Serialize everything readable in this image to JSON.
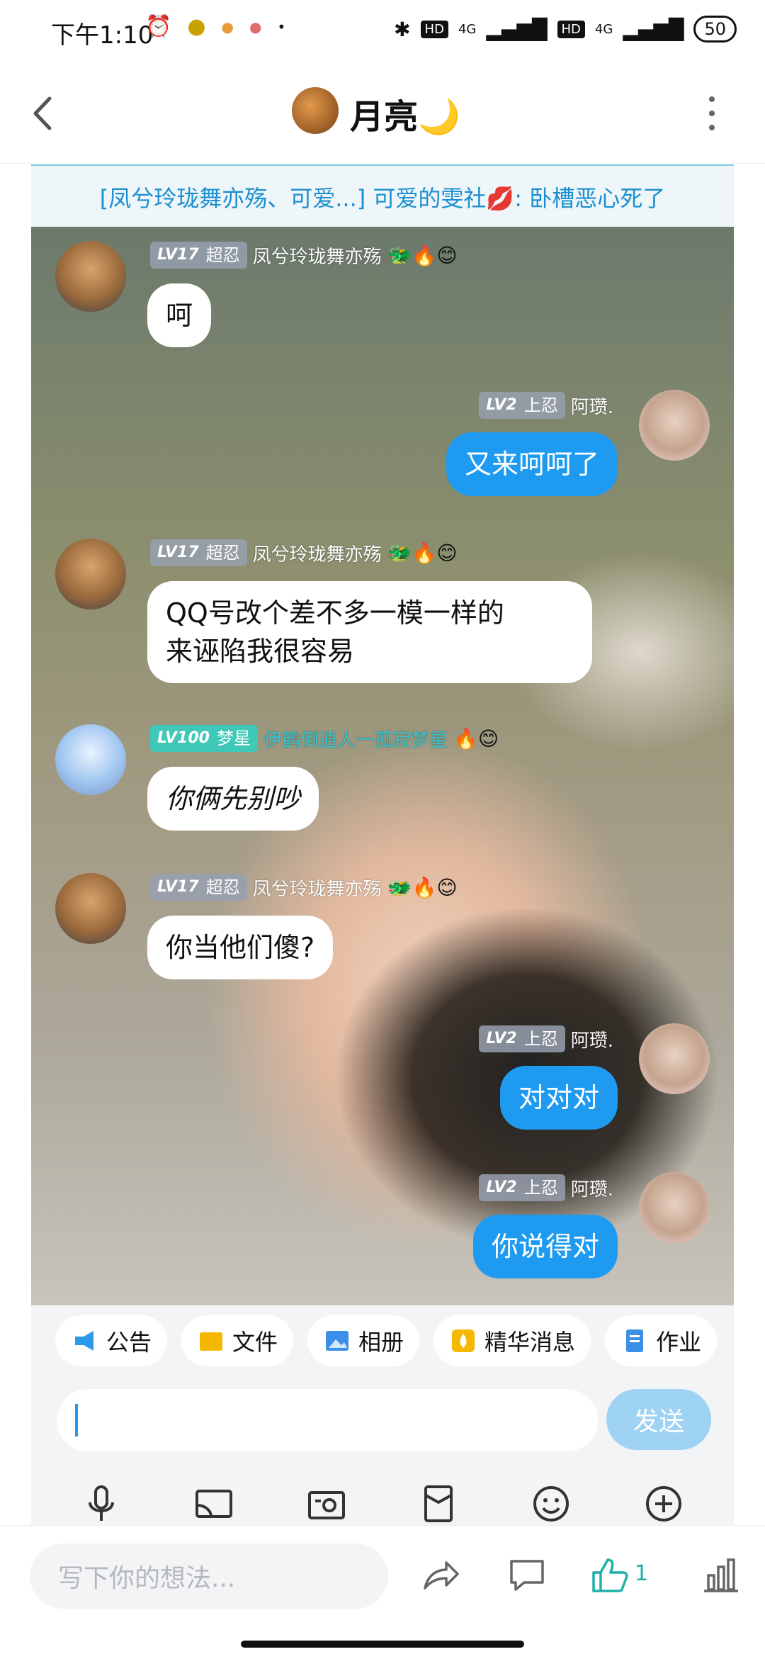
{
  "status_bar": {
    "time": "下午1:10",
    "battery": "50",
    "network_1": "4G",
    "network_2": "4G",
    "hd_1": "HD",
    "hd_2": "HD"
  },
  "header": {
    "title": "月亮🌙"
  },
  "marquee": {
    "text": "[凤兮玲珑舞亦殇、可爱...] 可爱的雯社💋: 卧槽恶心死了"
  },
  "messages": [
    {
      "side": "left",
      "avatar": "dog-avatar",
      "level": "LV17",
      "rank": "超忍",
      "sender": "凤兮玲珑舞亦殇",
      "emojis": "🐲🔥😊",
      "text": "呵"
    },
    {
      "side": "right",
      "avatar": "cat-avatar",
      "level": "LV2",
      "rank": "上忍",
      "sender": "阿瓒.",
      "text": "又来呵呵了"
    },
    {
      "side": "left",
      "avatar": "dog-avatar",
      "level": "LV17",
      "rank": "超忍",
      "sender": "凤兮玲珑舞亦殇",
      "emojis": "🐲🔥😊",
      "text": "QQ号改个差不多一模一样的\n来诬陷我很容易"
    },
    {
      "side": "left",
      "avatar": "anime-avatar",
      "level": "LV100",
      "rank": "梦星",
      "sender": "伊鹤倒逍人一孤寂梦星",
      "emojis": "🔥😊",
      "text": "你俩先别吵"
    },
    {
      "side": "left",
      "avatar": "dog-avatar",
      "level": "LV17",
      "rank": "超忍",
      "sender": "凤兮玲珑舞亦殇",
      "emojis": "🐲🔥😊",
      "text": "你当他们傻?"
    },
    {
      "side": "right",
      "avatar": "cat-avatar",
      "level": "LV2",
      "rank": "上忍",
      "sender": "阿瓒.",
      "text": "对对对"
    },
    {
      "side": "right",
      "avatar": "cat-avatar",
      "level": "LV2",
      "rank": "上忍",
      "sender": "阿瓒.",
      "text": "你说得对"
    }
  ],
  "toolbar": {
    "chips": [
      {
        "label": "公告",
        "icon": "megaphone-icon",
        "color": "#2b9ae8"
      },
      {
        "label": "文件",
        "icon": "folder-icon",
        "color": "#f5b800"
      },
      {
        "label": "相册",
        "icon": "photo-icon",
        "color": "#3b8fe6"
      },
      {
        "label": "精华消息",
        "icon": "essence-icon",
        "color": "#f5b800"
      },
      {
        "label": "作业",
        "icon": "homework-icon",
        "color": "#3b8fe6"
      }
    ]
  },
  "input": {
    "value": "",
    "send_label": "发送"
  },
  "function_icons": [
    "microphone-icon",
    "screen-cast-icon",
    "camera-icon",
    "red-packet-icon",
    "emoji-icon",
    "plus-icon"
  ],
  "bottom_bar": {
    "placeholder": "写下你的想法...",
    "like_count": "1"
  },
  "colors": {
    "accent": "#1e9af0",
    "send_disabled": "#9fd3f4",
    "marquee_text": "#1b8fcf",
    "like": "#1eb0a8"
  }
}
